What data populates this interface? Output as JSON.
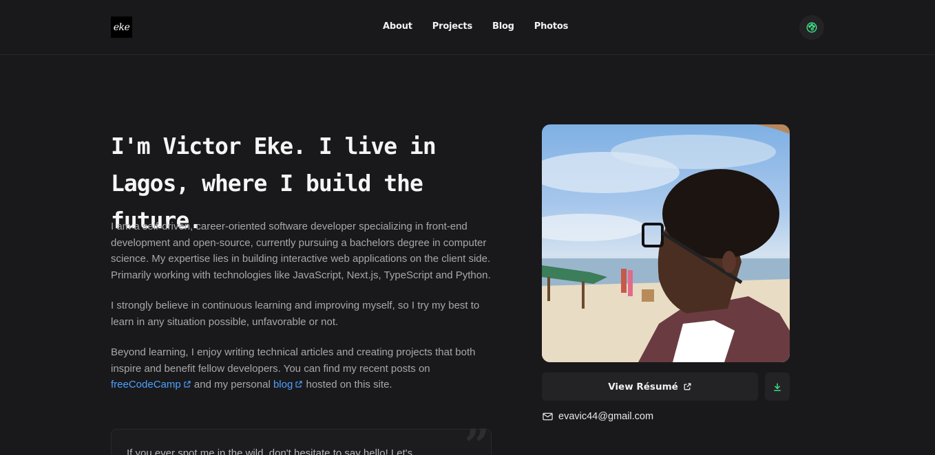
{
  "header": {
    "logo_text": "eke",
    "nav": [
      "About",
      "Projects",
      "Blog",
      "Photos"
    ],
    "theme_icon": "palette-icon",
    "accent_color": "#3ddc84"
  },
  "hero": {
    "heading": "I'm Victor Eke. I live in Lagos, where I build the future.",
    "paragraph_1": "I am a self-driven, career-oriented software developer specializing in front-end development and open-source, currently pursuing a bachelors degree in computer science. My expertise lies in building interactive web applications on the client side. Primarily working with technologies like JavaScript, Next.js, TypeScript and Python.",
    "paragraph_2": "I strongly believe in continuous learning and improving myself, so I try my best to learn in any situation possible, unfavorable or not.",
    "paragraph_3_before": "Beyond learning, I enjoy writing technical articles and creating projects that both inspire and benefit fellow developers. You can find my recent posts on",
    "link_freecodecamp": "freeCodeCamp",
    "paragraph_3_middle": "and my personal",
    "link_blog": "blog",
    "paragraph_3_after": "hosted on this site.",
    "link_color": "#4ea1ff"
  },
  "quote": {
    "text": "If you ever spot me in the wild, don't hesitate to say hello! Let's"
  },
  "sidebar": {
    "resume_label": "View Résumé",
    "email": "evavic44@gmail.com"
  }
}
